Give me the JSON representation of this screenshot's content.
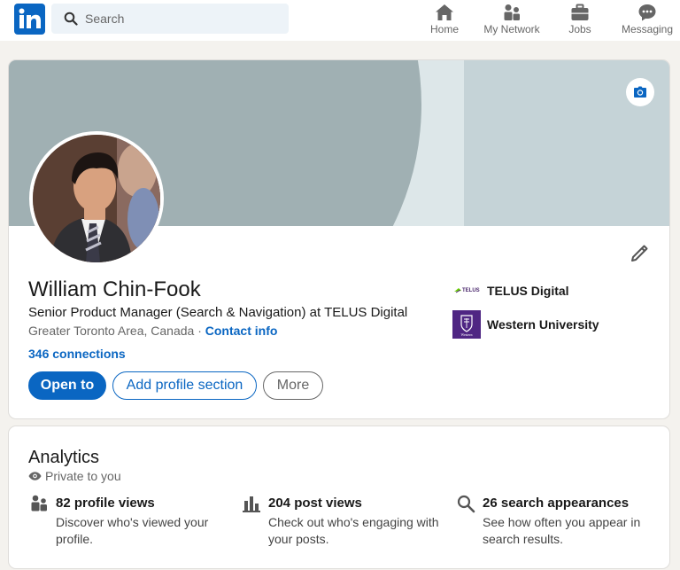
{
  "nav": {
    "search_placeholder": "Search",
    "items": [
      {
        "label": "Home",
        "icon": "home-icon"
      },
      {
        "label": "My Network",
        "icon": "network-icon"
      },
      {
        "label": "Jobs",
        "icon": "briefcase-icon"
      },
      {
        "label": "Messaging",
        "icon": "messaging-icon"
      }
    ]
  },
  "profile": {
    "name": "William Chin-Fook",
    "headline": "Senior Product Manager (Search & Navigation) at TELUS Digital",
    "location": "Greater Toronto Area, Canada",
    "separator": " · ",
    "contact_info": "Contact info",
    "connections": "346 connections",
    "buttons": {
      "open_to": "Open to",
      "add_section": "Add profile section",
      "more": "More"
    },
    "organizations": [
      {
        "name": "TELUS Digital",
        "logo": "telus-digital-logo",
        "logo_text": "TELUS"
      },
      {
        "name": "Western University",
        "logo": "western-university-logo",
        "logo_text": "Western"
      }
    ]
  },
  "analytics": {
    "title": "Analytics",
    "privacy": "Private to you",
    "metrics": [
      {
        "title": "82 profile views",
        "desc": "Discover who's viewed your profile.",
        "icon": "people-icon"
      },
      {
        "title": "204 post views",
        "desc": "Check out who's engaging with your posts.",
        "icon": "bar-chart-icon"
      },
      {
        "title": "26 search appearances",
        "desc": "See how often you appear in search results.",
        "icon": "search-icon"
      }
    ]
  },
  "colors": {
    "brand": "#0a66c2",
    "background": "#f4f2ee",
    "western_purple": "#4f2683"
  }
}
